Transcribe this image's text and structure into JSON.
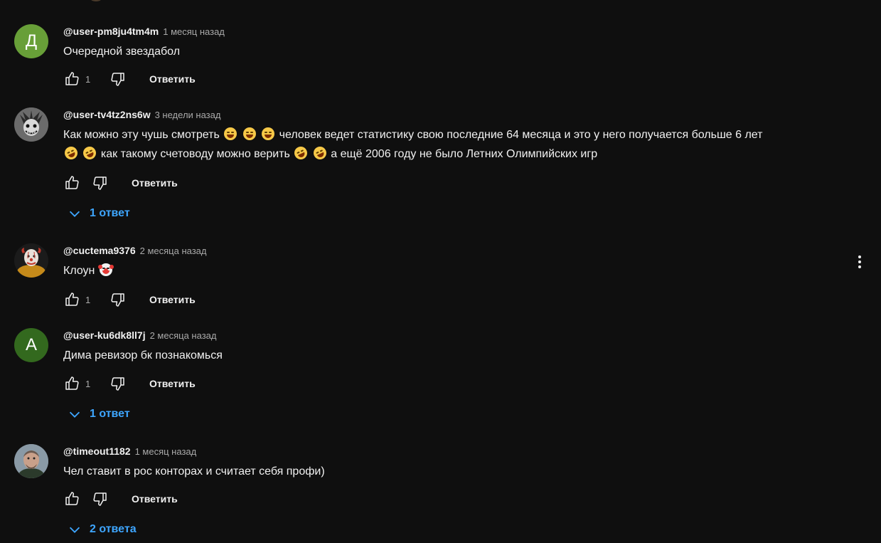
{
  "labels": {
    "reply": "Ответить"
  },
  "colors": {
    "background": "#0f0f0f",
    "link_blue": "#3ea6ff",
    "avatar_green": "#689f38",
    "avatar_dark_green": "#33691e"
  },
  "comments": [
    {
      "author": "@user-pm8ju4tm4m",
      "time": "1 месяц назад",
      "avatar_letter": "Д",
      "text": "Очередной звездабол",
      "likes": "1"
    },
    {
      "author": "@user-tv4tz2ns6w",
      "time": "3 недели назад",
      "avatar_icon": "joker-avatar-icon",
      "text_line1_a": "Как можно эту чушь смотреть",
      "text_line1_b": "человек ведет статистику свою последние 64 месяца и это у него получается больше 6 лет",
      "text_line2_a": "как такому счетоводу можно верить",
      "text_line2_b": "а ещё 2006 году не было Летних Олимпийских игр",
      "emoji_1": "laughing-emoji",
      "emoji_2": "rofl-emoji",
      "likes": "",
      "replies": "1 ответ"
    },
    {
      "author": "@cuctema9376",
      "time": "2 месяца назад",
      "avatar_icon": "clown-avatar-icon",
      "text": "Клоун",
      "emoji": "clown-emoji",
      "likes": "1"
    },
    {
      "author": "@user-ku6dk8ll7j",
      "time": "2 месяца назад",
      "avatar_letter": "А",
      "text": "Дима ревизор бк познакомься",
      "likes": "1",
      "replies": "1 ответ"
    },
    {
      "author": "@timeout1182",
      "time": "1 месяц назад",
      "avatar_icon": "man-avatar-icon",
      "text": "Чел ставит в рос конторах и считает себя профи)",
      "likes": "",
      "replies": "2 ответа"
    }
  ]
}
